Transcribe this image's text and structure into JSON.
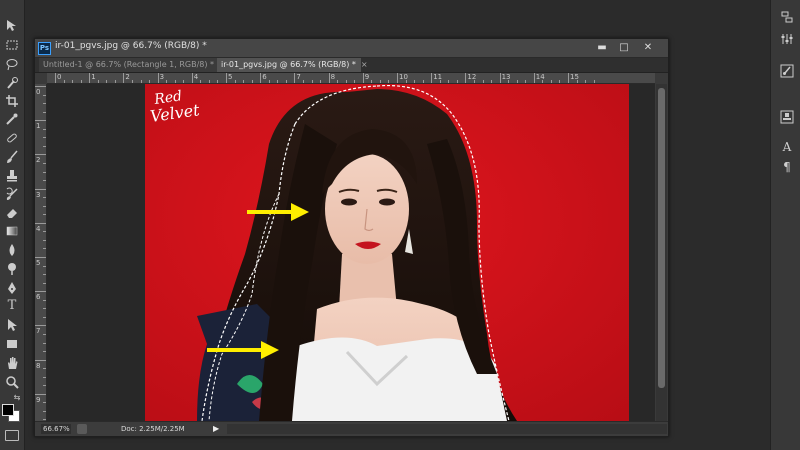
{
  "window": {
    "title": "ir-01_pgvs.jpg @ 66.7% (RGB/8) *",
    "app_icon": "Ps",
    "minimize_glyph": "▬",
    "maximize_glyph": "□",
    "close_glyph": "✕"
  },
  "tabs": [
    {
      "label": "Untitled-1 @ 66.7% (Rectangle 1, RGB/8) *",
      "active": false
    },
    {
      "label": "ir-01_pgvs.jpg @ 66.7% (RGB/8) *",
      "active": true
    }
  ],
  "tab_close_glyph": "×",
  "rulers": {
    "horizontal": [
      "0",
      "1",
      "2",
      "3",
      "4",
      "5",
      "6",
      "7",
      "8",
      "9",
      "10",
      "11",
      "12",
      "13",
      "14",
      "15"
    ],
    "vertical": [
      "0",
      "1",
      "2",
      "3",
      "4",
      "5",
      "6",
      "7",
      "8",
      "9"
    ]
  },
  "image": {
    "logo_line1": "Red",
    "logo_line2": "Velvet"
  },
  "status": {
    "zoom": "66.67%",
    "doc_info": "Doc: 2.25M/2.25M",
    "arrow": "▶"
  },
  "toolbar": {
    "tools": [
      "move-tool",
      "marquee-tool",
      "lasso-tool",
      "quick-selection-tool",
      "crop-tool",
      "eyedropper-tool",
      "healing-brush-tool",
      "brush-tool",
      "clone-stamp-tool",
      "history-brush-tool",
      "eraser-tool",
      "gradient-tool",
      "blur-tool",
      "dodge-tool",
      "pen-tool",
      "type-tool",
      "path-selection-tool",
      "shape-tool",
      "hand-tool",
      "zoom-tool"
    ],
    "type_glyph": "T",
    "foreground_color": "#000000",
    "background_color": "#ffffff"
  },
  "right_dock": {
    "items": [
      "history-icon",
      "adjust-icon",
      "brush-panel-icon",
      "clone-panel-icon",
      "character-icon",
      "paragraph-icon"
    ],
    "character_glyph": "A",
    "paragraph_glyph": "¶"
  },
  "colors": {
    "arrow": "#ffee00",
    "photo_red": "#d0121c",
    "selection": "#ffffff"
  }
}
